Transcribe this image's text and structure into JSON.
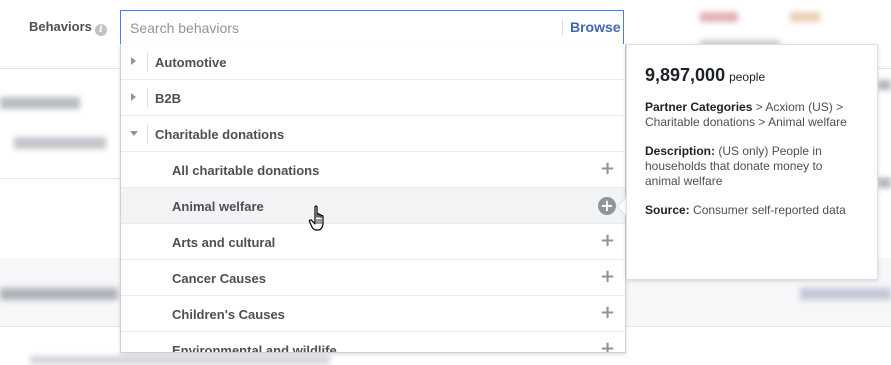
{
  "behaviors": {
    "label": "Behaviors",
    "info_icon": "i"
  },
  "search": {
    "placeholder": "Search behaviors",
    "browse_label": "Browse"
  },
  "dropdown": {
    "items": [
      {
        "label": "Automotive",
        "expanded": false,
        "level": 0
      },
      {
        "label": "B2B",
        "expanded": false,
        "level": 0
      },
      {
        "label": "Charitable donations",
        "expanded": true,
        "level": 0
      },
      {
        "label": "All charitable donations",
        "level": 1
      },
      {
        "label": "Animal welfare",
        "level": 1,
        "hovered": true
      },
      {
        "label": "Arts and cultural",
        "level": 1
      },
      {
        "label": "Cancer Causes",
        "level": 1
      },
      {
        "label": "Children's Causes",
        "level": 1
      },
      {
        "label": "Environmental and wildlife",
        "level": 1
      }
    ],
    "add_icon": "+"
  },
  "tooltip": {
    "count": "9,897,000",
    "count_unit": "people",
    "path_label": "Partner Categories",
    "path_1": "Acxiom (US)",
    "path_2": "Charitable donations",
    "path_3": "Animal welfare",
    "path_separator": ">",
    "description_label": "Description:",
    "description": "(US only) People in households that donate money to animal welfare",
    "source_label": "Source:",
    "source": "Consumer self-reported data"
  },
  "colors": {
    "accent": "#4267b2",
    "focus_border": "#4080ff",
    "icon_gray": "#90949c"
  },
  "icons": {
    "expand_collapsed": "caret-right-icon",
    "expand_open": "caret-down-icon",
    "add": "plus-icon",
    "add_hover": "plus-circle-icon",
    "cursor": "hand-pointer-icon",
    "info": "info-icon"
  }
}
